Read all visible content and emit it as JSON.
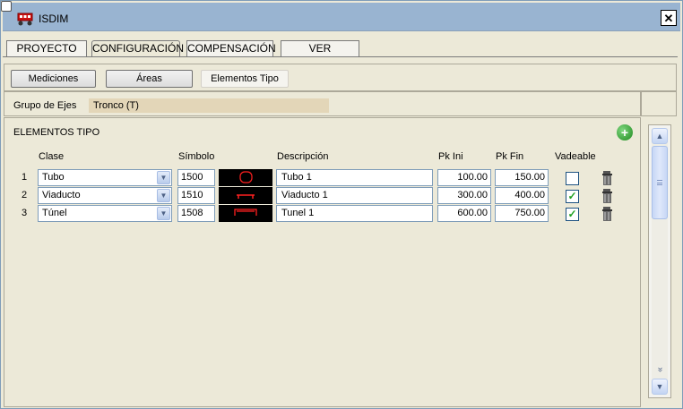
{
  "window": {
    "title": "ISDIM",
    "close_glyph": "✕"
  },
  "main_tabs": [
    {
      "label": "PROYECTO"
    },
    {
      "label": "CONFIGURACIÓN"
    },
    {
      "label": "COMPENSACIÓN"
    },
    {
      "label": "VER"
    }
  ],
  "active_main_tab": "CONFIGURACIÓN",
  "sub_tabs": [
    {
      "label": "Mediciones"
    },
    {
      "label": "Áreas"
    },
    {
      "label": "Elementos Tipo"
    }
  ],
  "active_sub_tab": "Elementos Tipo",
  "grupo": {
    "label": "Grupo de Ejes",
    "value": "Tronco (T)"
  },
  "section": {
    "title": "ELEMENTOS TIPO",
    "add_glyph": "+"
  },
  "columns": {
    "clase": "Clase",
    "simbolo": "Símbolo",
    "descripcion": "Descripción",
    "pk_ini": "Pk Ini",
    "pk_fin": "Pk Fin",
    "vadeable": "Vadeable"
  },
  "rows": [
    {
      "num": "1",
      "clase": "Tubo",
      "simbolo": "1500",
      "descripcion": "Tubo 1",
      "pk_ini": "100.00",
      "pk_fin": "150.00",
      "vadeable": false,
      "vadeable_mark": ""
    },
    {
      "num": "2",
      "clase": "Viaducto",
      "simbolo": "1510",
      "descripcion": "Viaducto 1",
      "pk_ini": "300.00",
      "pk_fin": "400.00",
      "vadeable": true,
      "vadeable_mark": "✓"
    },
    {
      "num": "3",
      "clase": "Túnel",
      "simbolo": "1508",
      "descripcion": "Tunel 1",
      "pk_ini": "600.00",
      "pk_fin": "750.00",
      "vadeable": true,
      "vadeable_mark": "✓"
    }
  ],
  "glyphs": {
    "combo_arrow": "▼",
    "scroll_up": "▲",
    "scroll_down": "▼",
    "scroll_page_down": "»"
  },
  "colors": {
    "titlebar": "#99b4d1",
    "symbol_bg": "#000000",
    "symbol_stroke": "#ff2020",
    "grupo_value_bg": "#e3d6b8",
    "check": "#21a121"
  },
  "icons": {
    "app": "isdim-train-icon",
    "add": "add-green-circle-icon",
    "delete": "trash-can-icon",
    "symbols": [
      "pipe-circle-symbol",
      "viaduct-symbol",
      "tunnel-symbol"
    ]
  }
}
